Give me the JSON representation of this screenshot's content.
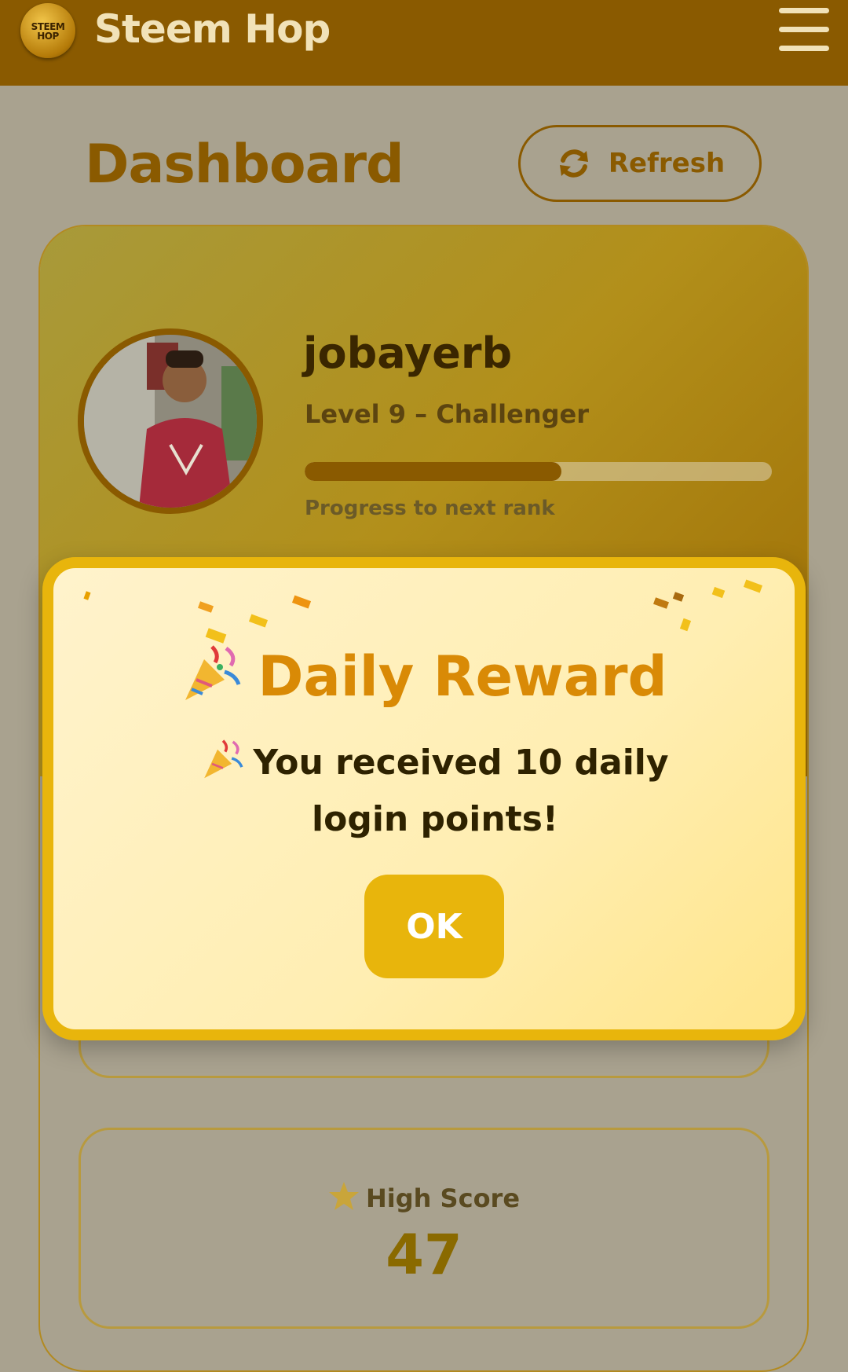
{
  "header": {
    "logo_text": "STEEM HOP",
    "brand": "Steem Hop",
    "menu_icon": "hamburger-menu-icon"
  },
  "page": {
    "title": "Dashboard",
    "refresh_label": "Refresh",
    "refresh_icon": "refresh-icon"
  },
  "profile": {
    "username": "jobayerb",
    "level": "Level 9 – Challenger",
    "progress_fraction": 0.55,
    "progress_label": "Progress to next rank"
  },
  "stats": {
    "high_score_icon": "star-icon",
    "high_score_label": "High Score",
    "high_score_value": "47"
  },
  "modal": {
    "title": "Daily Reward",
    "title_icon": "party-popper-icon",
    "message": "You received 10 daily login points!",
    "message_icon": "party-popper-icon",
    "ok_label": "OK"
  },
  "colors": {
    "header_bg": "#8a5a00",
    "accent": "#e8b50c",
    "title": "#d98a06"
  }
}
